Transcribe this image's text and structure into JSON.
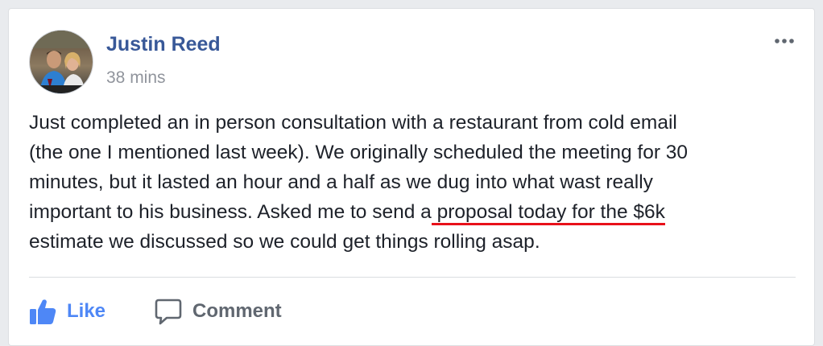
{
  "post": {
    "author": "Justin Reed",
    "timestamp": "38 mins",
    "text_lines": [
      {
        "before": "Just completed an in person consultation with a restaurant from cold email",
        "highlight": "",
        "after": ""
      },
      {
        "before": "(the one I mentioned last week). We originally scheduled the meeting for 30",
        "highlight": "",
        "after": ""
      },
      {
        "before": "minutes, but it lasted an hour and a half as we dug into what wast really",
        "highlight": "",
        "after": ""
      },
      {
        "before": "important to his business. Asked me to send a",
        "highlight": " proposal today for the $6k",
        "after": ""
      },
      {
        "before": "estimate we discussed so we could get things rolling asap.",
        "highlight": "",
        "after": ""
      }
    ],
    "avatar_icon": "profile-photo",
    "more_icon": "ellipsis-icon"
  },
  "actions": {
    "like_label": "Like",
    "like_icon": "thumbs-up-icon",
    "comment_label": "Comment",
    "comment_icon": "speech-bubble-icon"
  },
  "colors": {
    "author": "#385898",
    "timestamp": "#90949c",
    "body_text": "#1d2129",
    "like": "#4e87f6",
    "comment": "#606770",
    "highlight_underline": "#e8101a"
  }
}
